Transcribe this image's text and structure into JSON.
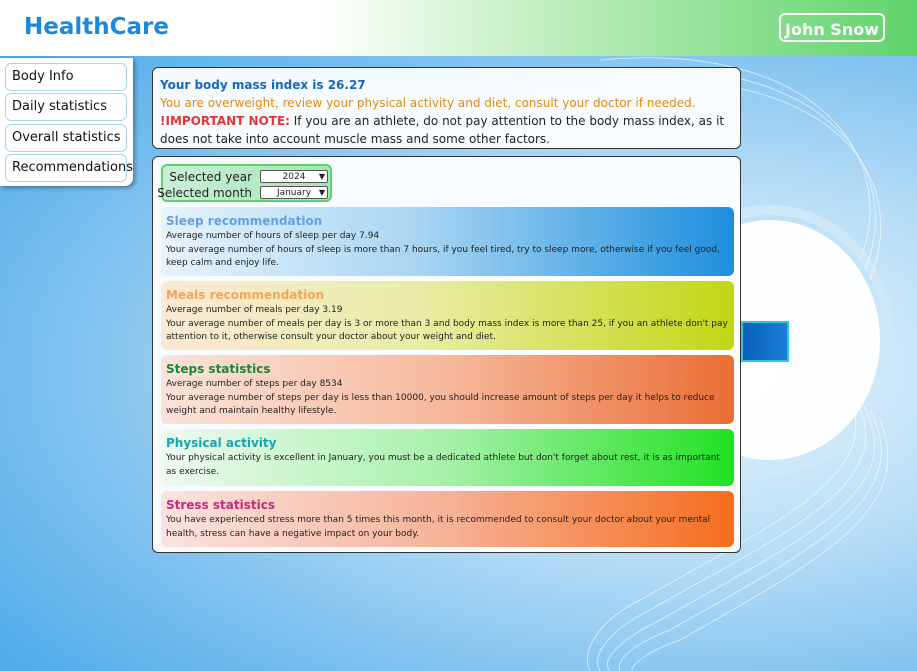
{
  "header": {
    "brand": "HealthCare",
    "user_name": "John Snow"
  },
  "sidebar": {
    "items": [
      {
        "label": "Body Info"
      },
      {
        "label": "Daily statistics"
      },
      {
        "label": "Overall statistics"
      },
      {
        "label": "Recommendations"
      }
    ]
  },
  "bmi": {
    "title": "Your body mass index is 26.27",
    "status": "You are overweight, review your physical activity and diet, consult your doctor if needed.",
    "important_label": "!IMPORTANT NOTE:",
    "important_text": " If you are an athlete, do not pay attention to the body mass index, as it does not take into account muscle mass and some other factors."
  },
  "filters": {
    "year_label": "Selected year",
    "year_value": "2024",
    "month_label": "Selected month",
    "month_value": "January"
  },
  "cards": {
    "sleep": {
      "title": "Sleep recommendation",
      "line1": "Average number of hours of sleep per day 7.94",
      "line2": "Your average number of hours of sleep is more than 7 hours, if you feel tired, try to sleep more, otherwise if you feel good, keep calm and enjoy life."
    },
    "meals": {
      "title": "Meals recommendation",
      "line1": "Average number of meals per day 3.19",
      "line2": "Your average number of meals per day is 3 or more than 3 and body mass index is more than 25, if you an athlete don't pay attention to it, otherwise consult your doctor about your weight and diet."
    },
    "steps": {
      "title": "Steps statistics",
      "line1": "Average number of steps per day 8534",
      "line2": "Your average number of steps per day is less than 10000, you should increase amount of steps per day it helps to reduce weight and maintain healthy lifestyle."
    },
    "physical": {
      "title": "Physical activity",
      "line1": "Your physical activity is excellent in January, you must be a dedicated athlete but don't forget about rest, it is as important as exercise."
    },
    "stress": {
      "title": "Stress statistics",
      "line1": "You have experienced stress more than 5 times this month, it is recommended to consult your doctor about your mental health, stress can have a negative impact on your body."
    }
  },
  "icons": {
    "dropdown": "chevron-down-icon"
  }
}
